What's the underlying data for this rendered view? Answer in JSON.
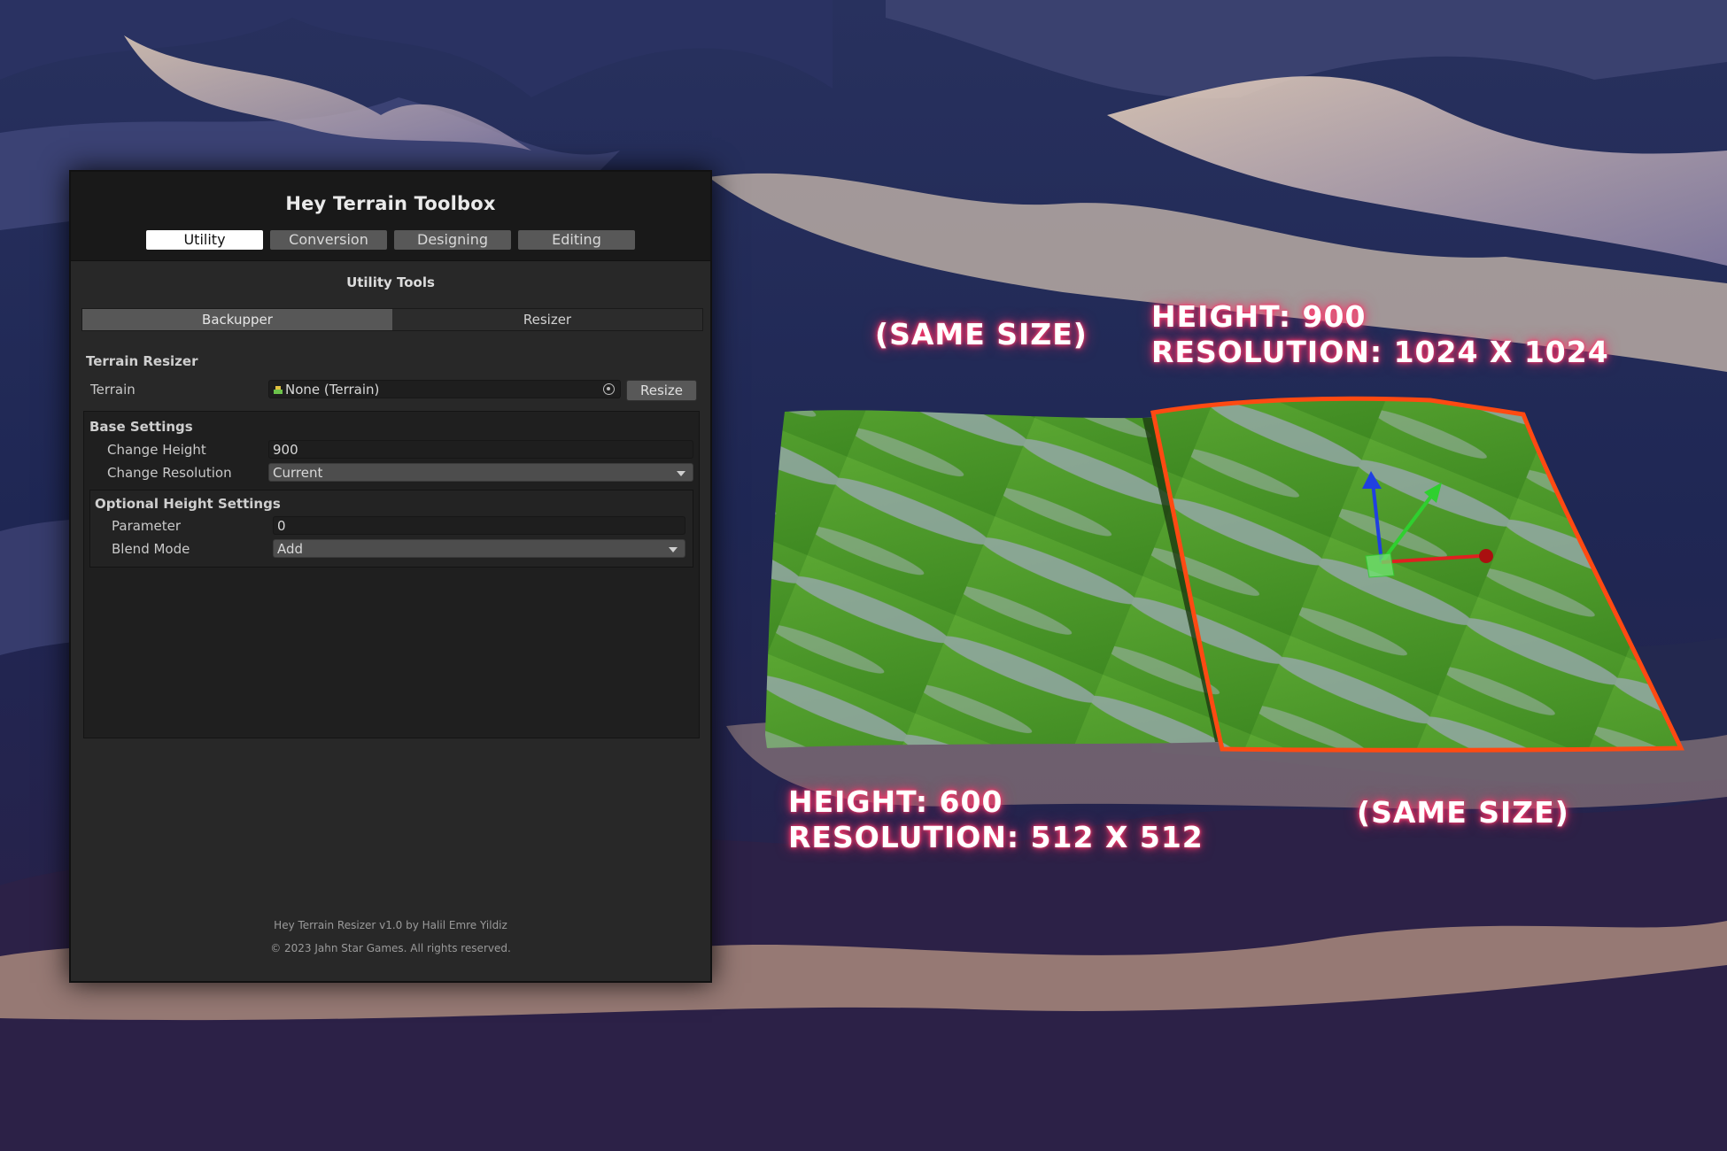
{
  "window": {
    "title": "Hey Terrain Toolbox",
    "tabs": [
      "Utility",
      "Conversion",
      "Designing",
      "Editing"
    ],
    "active_tab": "Utility",
    "section_title": "Utility Tools",
    "sub_tabs": [
      "Backupper",
      "Resizer"
    ],
    "active_sub_tab": "Backupper",
    "resizer": {
      "group_title": "Terrain Resizer",
      "terrain_label": "Terrain",
      "terrain_value": "None (Terrain)",
      "resize_button": "Resize"
    },
    "base_settings": {
      "title": "Base Settings",
      "change_height_label": "Change Height",
      "change_height_value": "900",
      "change_resolution_label": "Change Resolution",
      "change_resolution_value": "Current"
    },
    "optional_height": {
      "title": "Optional Height Settings",
      "parameter_label": "Parameter",
      "parameter_value": "0",
      "blend_mode_label": "Blend Mode",
      "blend_mode_value": "Add"
    },
    "footer": {
      "line1": "Hey Terrain Resizer v1.0 by Halil Emre Yildiz",
      "line2": "© 2023 Jahn Star Games. All rights reserved."
    }
  },
  "annotations": {
    "same_size_top": "(SAME SIZE)",
    "right_height": "HEIGHT: 900",
    "right_resolution": "RESOLUTION: 1024 X 1024",
    "left_height": "HEIGHT: 600",
    "left_resolution": "RESOLUTION: 512 X 512",
    "same_size_bottom": "(SAME SIZE)"
  },
  "colors": {
    "highlight_outline": "#ff4a12",
    "terrain_grass": "#4f9a2c",
    "terrain_rock": "#8a9aa8",
    "gizmo_x": "#e02020",
    "gizmo_y": "#2fd02f",
    "gizmo_z": "#2040e0"
  },
  "icons": [
    "terrain-icon",
    "object-picker-icon",
    "dropdown-arrow-icon"
  ]
}
